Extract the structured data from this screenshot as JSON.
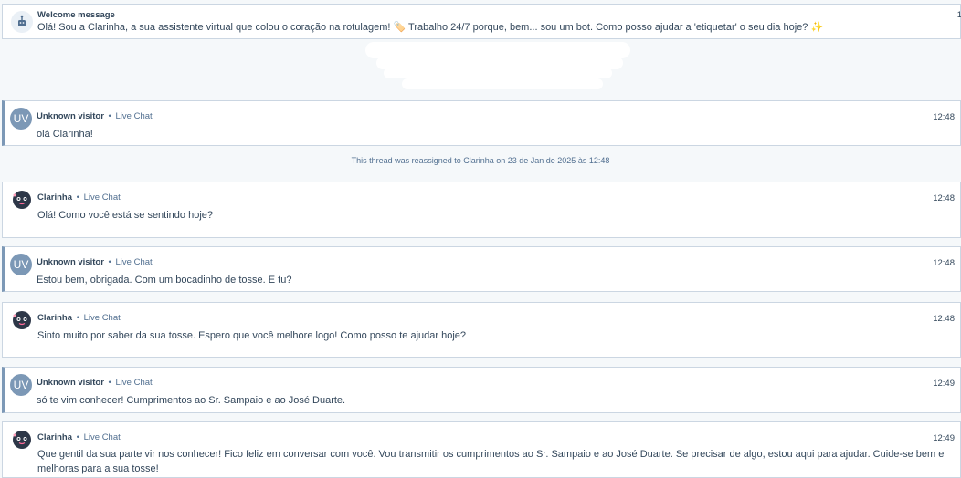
{
  "welcome": {
    "title": "Welcome message",
    "time": "1",
    "text": "Olá! Sou a Clarinha, a sua assistente virtual que colou o coração na rotulagem! 🏷️ Trabalho 24/7 porque, bem... sou um bot. Como posso ajudar a 'etiquetar' o seu dia hoje? ✨"
  },
  "system_notice": "This thread was reassigned to Clarinha on 23 de Jan de 2025 às 12:48",
  "messages": [
    {
      "sender": "Unknown visitor",
      "initials": "UV",
      "channel": "Live Chat",
      "time": "12:48",
      "text": "olá Clarinha!"
    },
    {
      "sender": "Clarinha",
      "channel": "Live Chat",
      "time": "12:48",
      "text": "Olá! Como você está se sentindo hoje?"
    },
    {
      "sender": "Unknown visitor",
      "initials": "UV",
      "channel": "Live Chat",
      "time": "12:48",
      "text": "Estou bem, obrigada. Com um bocadinho de tosse. E tu?"
    },
    {
      "sender": "Clarinha",
      "channel": "Live Chat",
      "time": "12:48",
      "text": "Sinto muito por saber da sua tosse. Espero que você melhore logo! Como posso te ajudar hoje?"
    },
    {
      "sender": "Unknown visitor",
      "initials": "UV",
      "channel": "Live Chat",
      "time": "12:49",
      "text": "só te vim conhecer! Cumprimentos ao Sr. Sampaio e ao José Duarte."
    },
    {
      "sender": "Clarinha",
      "channel": "Live Chat",
      "time": "12:49",
      "text": "Que gentil da sua parte vir nos conhecer! Fico feliz em conversar com você. Vou transmitir os cumprimentos ao Sr. Sampaio e ao José Duarte. Se precisar de algo, estou aqui para ajudar. Cuide-se bem e melhoras para a sua tosse!"
    }
  ],
  "separator": "•"
}
